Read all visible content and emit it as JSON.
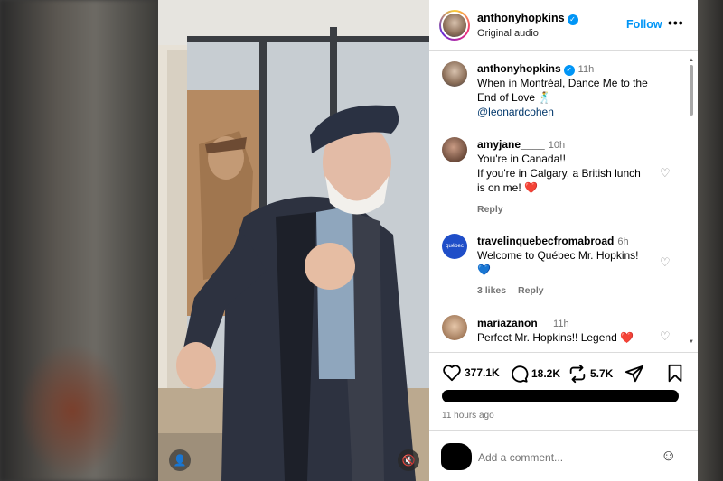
{
  "post": {
    "author": "anthonyhopkins",
    "audio": "Original audio",
    "follow_label": "Follow",
    "more_label": "•••"
  },
  "comments": [
    {
      "user": "anthonyhopkins",
      "verified": true,
      "time": "11h",
      "lines": [
        "When in Montréal, Dance Me to the",
        "End of Love 🕺",
        "@leonardcohen"
      ],
      "avatar_color": "#8a6d57"
    },
    {
      "user": "amyjane____",
      "time": "10h",
      "lines": [
        "You're in Canada!!",
        "If you're in Calgary, a British lunch",
        "is on me! ❤️"
      ],
      "meta": "Reply",
      "avatar_color": "#6b4a3a"
    },
    {
      "user": "travelinquebecfromabroad",
      "time": "6h",
      "lines": [
        "Welcome to Québec Mr. Hopkins!",
        "💙"
      ],
      "likes": "3 likes",
      "meta": "Reply",
      "avatar_text": "québec",
      "avatar_color": "#1f4ec8"
    },
    {
      "user": "mariazanon__",
      "time": "11h",
      "lines": [
        "Perfect Mr. Hopkins!! Legend ❤️"
      ],
      "avatar_color": "#c9a88a"
    }
  ],
  "actions": {
    "likes": "377.1K",
    "comments": "18.2K",
    "reposts": "5.7K"
  },
  "time_ago": "11 hours ago",
  "add_comment_placeholder": "Add a comment...",
  "icons": {
    "heart": "heart-icon",
    "comment": "comment-icon",
    "repost": "repost-icon",
    "share": "share-icon",
    "save": "bookmark-icon",
    "emoji": "emoji-icon"
  },
  "colors": {
    "accent": "#0095f6",
    "heart_red": "#ed4956",
    "muted": "#737373"
  }
}
